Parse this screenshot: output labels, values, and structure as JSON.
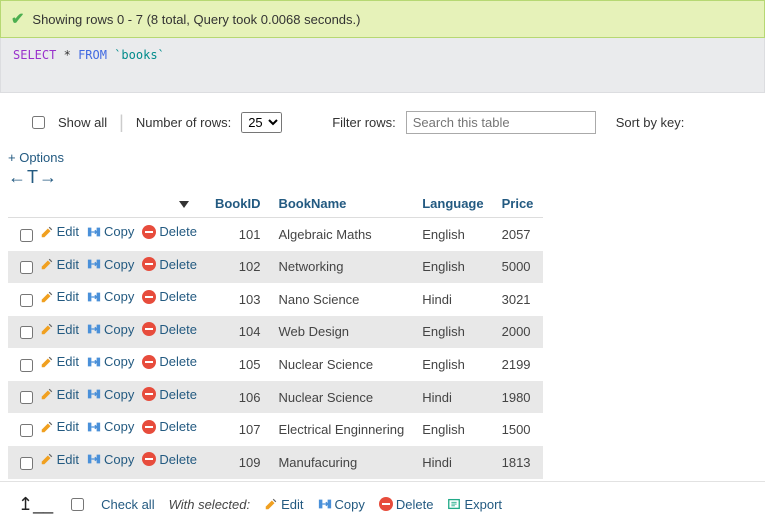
{
  "success": {
    "text": "Showing rows 0 - 7 (8 total, Query took 0.0068 seconds.)"
  },
  "sql": {
    "select": "SELECT",
    "star": "*",
    "from": "FROM",
    "table": "`books`"
  },
  "controls": {
    "show_all": "Show all",
    "num_rows_label": "Number of rows:",
    "num_rows_value": "25",
    "filter_label": "Filter rows:",
    "filter_placeholder": "Search this table",
    "sort_label": "Sort by key:"
  },
  "options_link": "+ Options",
  "sort_symbols": "←T→",
  "columns": {
    "book_id": "BookID",
    "book_name": "BookName",
    "language": "Language",
    "price": "Price"
  },
  "actions": {
    "edit": "Edit",
    "copy": "Copy",
    "delete": "Delete",
    "export": "Export"
  },
  "rows": [
    {
      "book_id": "101",
      "book_name": "Algebraic Maths",
      "language": "English",
      "price": "2057"
    },
    {
      "book_id": "102",
      "book_name": "Networking",
      "language": "English",
      "price": "5000"
    },
    {
      "book_id": "103",
      "book_name": "Nano Science",
      "language": "Hindi",
      "price": "3021"
    },
    {
      "book_id": "104",
      "book_name": "Web Design",
      "language": "English",
      "price": "2000"
    },
    {
      "book_id": "105",
      "book_name": "Nuclear Science",
      "language": "English",
      "price": "2199"
    },
    {
      "book_id": "106",
      "book_name": "Nuclear Science",
      "language": "Hindi",
      "price": "1980"
    },
    {
      "book_id": "107",
      "book_name": "Electrical Enginnering",
      "language": "English",
      "price": "1500"
    },
    {
      "book_id": "109",
      "book_name": "Manufacuring",
      "language": "Hindi",
      "price": "1813"
    }
  ],
  "footer": {
    "check_all": "Check all",
    "with_selected": "With selected:"
  }
}
